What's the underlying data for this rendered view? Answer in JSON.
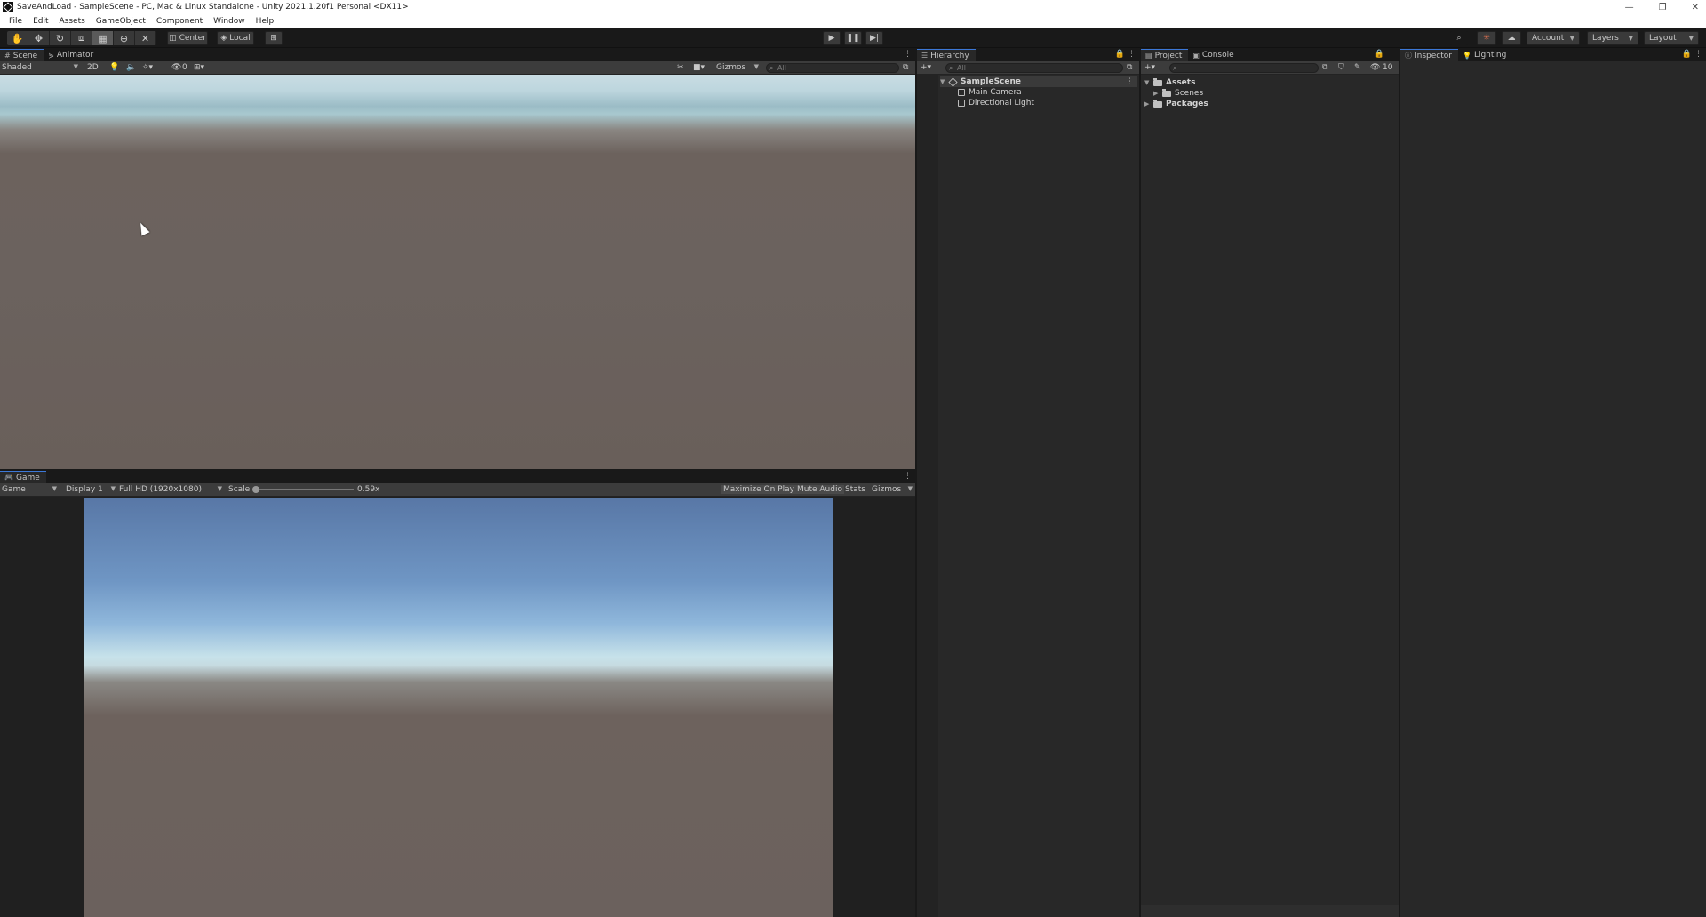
{
  "window": {
    "title": "SaveAndLoad - SampleScene - PC, Mac & Linux Standalone - Unity 2021.1.20f1 Personal <DX11>",
    "controls": [
      "—",
      "❐",
      "✕"
    ]
  },
  "menu": [
    "File",
    "Edit",
    "Assets",
    "GameObject",
    "Component",
    "Window",
    "Help"
  ],
  "toolbar": {
    "tools": [
      "hand-tool-icon",
      "move-tool-icon",
      "rotate-tool-icon",
      "scale-tool-icon",
      "rect-tool-icon",
      "transform-tool-icon",
      "custom-tool-icon"
    ],
    "pivot_label": "Center",
    "space_label": "Local",
    "account_label": "Account",
    "layers_label": "Layers",
    "layout_label": "Layout"
  },
  "scene": {
    "tabs": [
      {
        "label": "Scene",
        "icon": "#"
      },
      {
        "label": "Animator",
        "icon": "⋟"
      }
    ],
    "shading_mode": "Shaded",
    "mode_2d": "2D",
    "hidden_count": "0",
    "gizmos_label": "Gizmos",
    "search_placeholder": "All"
  },
  "game": {
    "tab_label": "Game",
    "view_mode": "Game",
    "display": "Display 1",
    "resolution": "Full HD (1920x1080)",
    "scale_label": "Scale",
    "scale_value": "0.59x",
    "scale_fraction": 0.0,
    "maximize_label": "Maximize On Play",
    "mute_label": "Mute Audio",
    "stats_label": "Stats",
    "gizmos_label": "Gizmos"
  },
  "hierarchy": {
    "tab_label": "Hierarchy",
    "search_placeholder": "All",
    "scene_name": "SampleScene",
    "items": [
      "Main Camera",
      "Directional Light"
    ]
  },
  "project": {
    "tabs": [
      "Project",
      "Console"
    ],
    "hidden_count": "10",
    "tree": [
      {
        "label": "Assets",
        "expanded": true
      },
      {
        "label": "Scenes",
        "expanded": false
      },
      {
        "label": "Packages",
        "expanded": false
      }
    ]
  },
  "inspector": {
    "tabs": [
      "Inspector",
      "Lighting"
    ]
  },
  "colors": {
    "accent": "#3c78d8",
    "panel_bg": "#282828",
    "toolbar_bg": "#3c3c3c"
  }
}
